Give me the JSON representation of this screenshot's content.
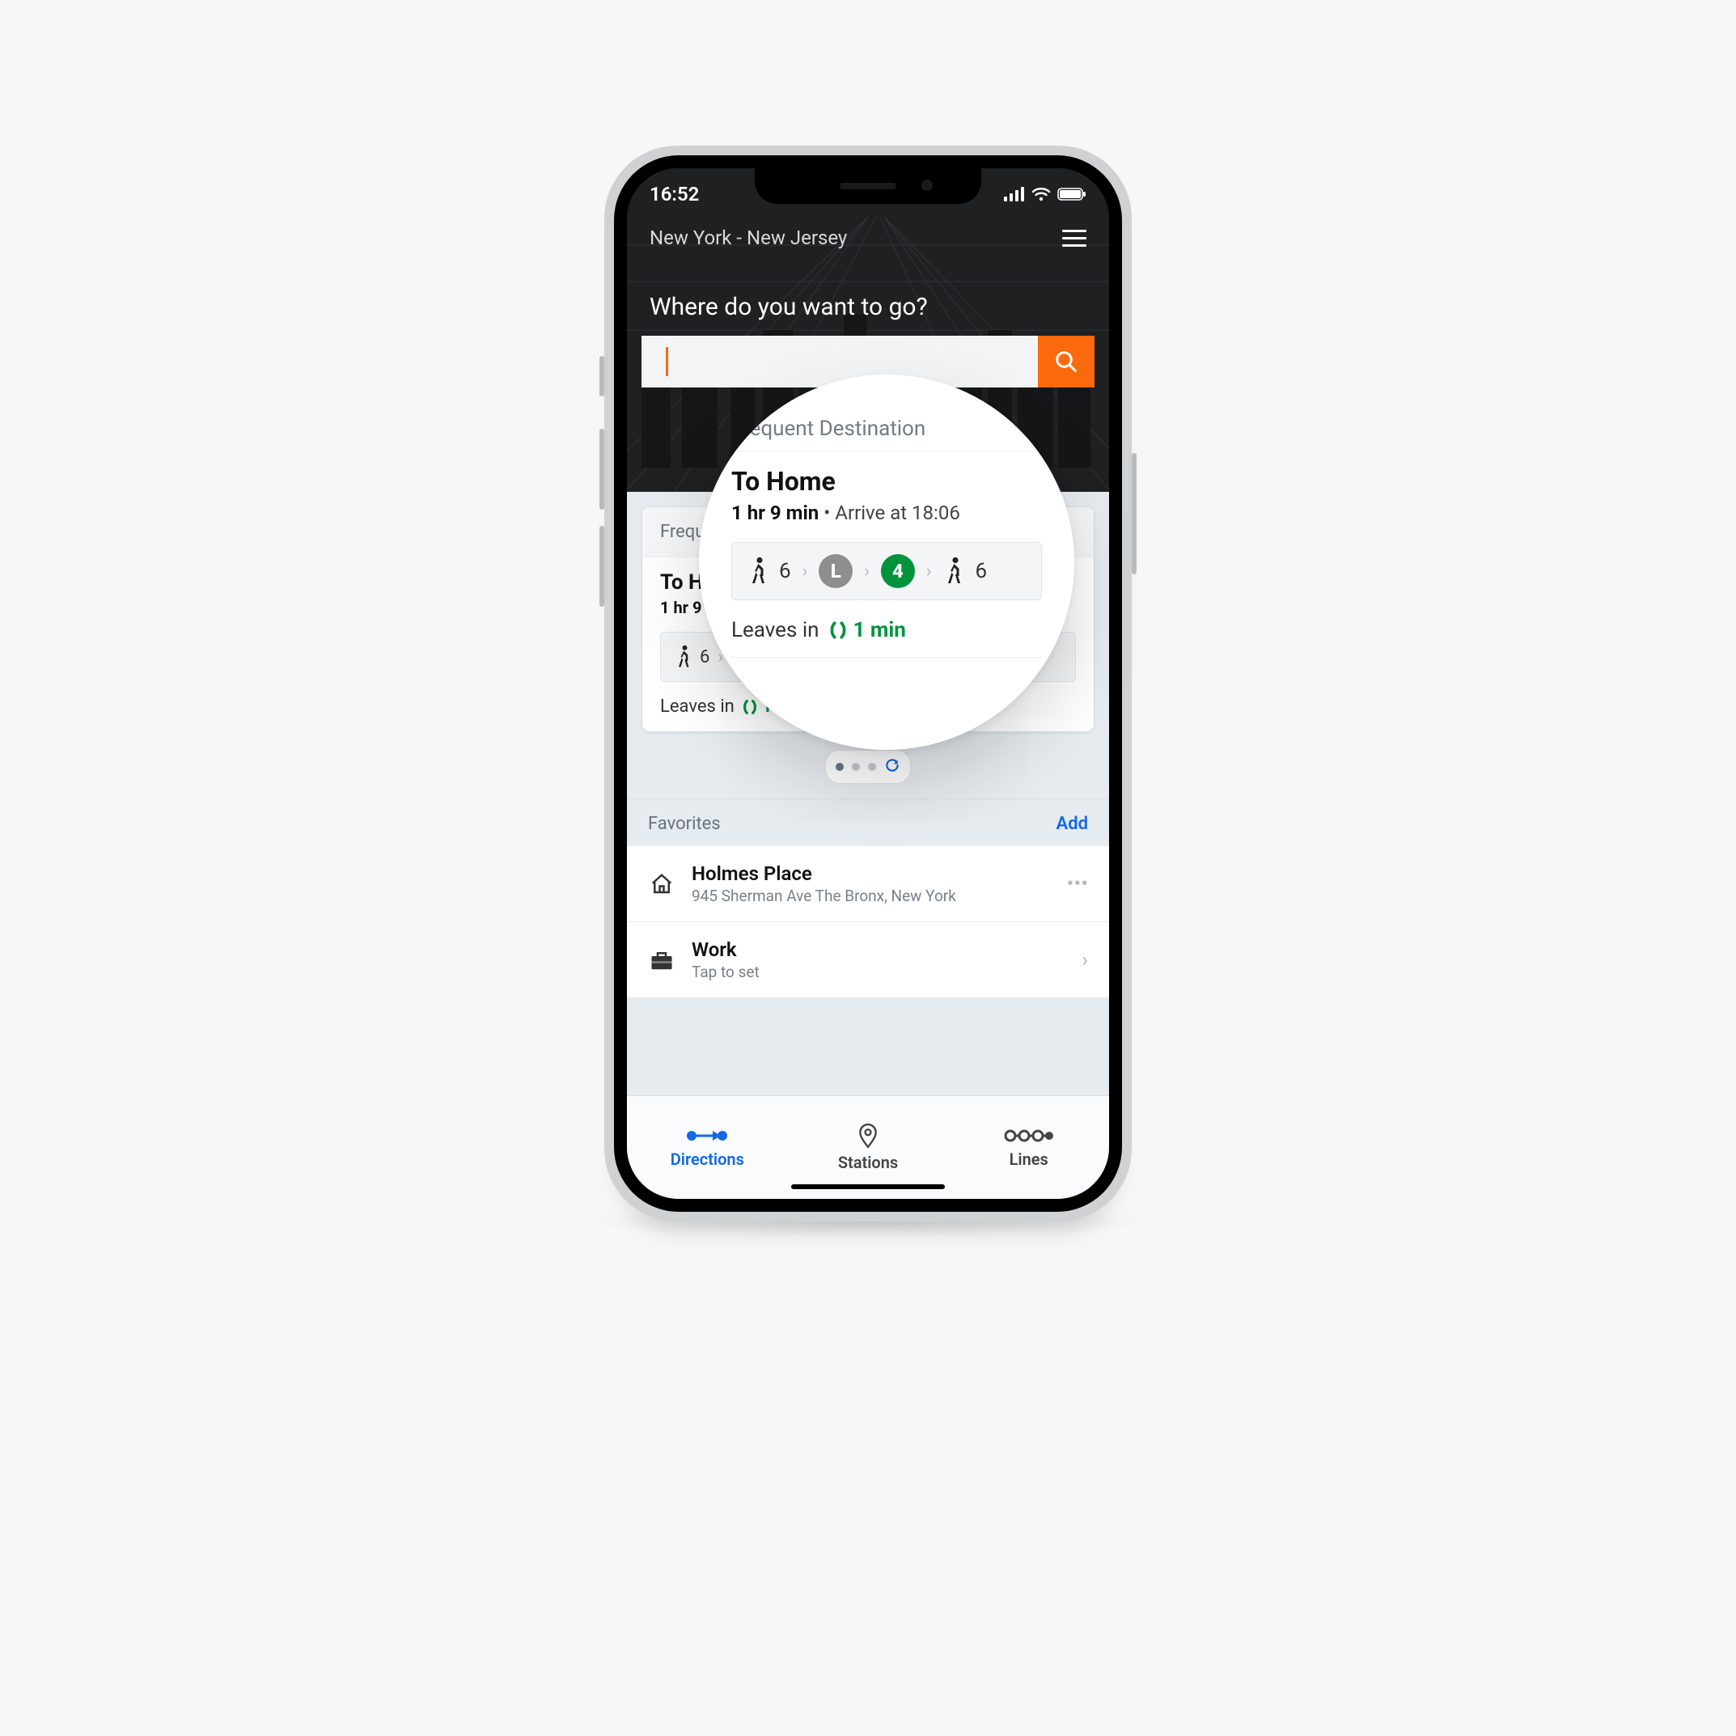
{
  "status": {
    "time": "16:52"
  },
  "hero": {
    "region": "New York - New Jersey",
    "prompt": "Where do you want to go?",
    "search_placeholder": ""
  },
  "frequent": {
    "section_label": "Frequent Destination",
    "title": "To Home",
    "duration": "1 hr 9 min",
    "arrive": "Arrive at 18:06",
    "steps": {
      "walk1": "6",
      "line1": "L",
      "line2": "4",
      "walk2": "6"
    },
    "leaves_label": "Leaves in",
    "leaves_value": "1 min"
  },
  "favorites": {
    "section_label": "Favorites",
    "add_label": "Add",
    "items": [
      {
        "title": "Holmes Place",
        "sub": "945 Sherman Ave The Bronx, New York"
      },
      {
        "title": "Work",
        "sub": "Tap to set"
      }
    ]
  },
  "tabs": {
    "directions": "Directions",
    "stations": "Stations",
    "lines": "Lines"
  },
  "colors": {
    "accent_orange": "#fb6a0c",
    "accent_blue": "#1368e6",
    "line_green": "#00933c",
    "line_grey": "#8e8e8e"
  }
}
